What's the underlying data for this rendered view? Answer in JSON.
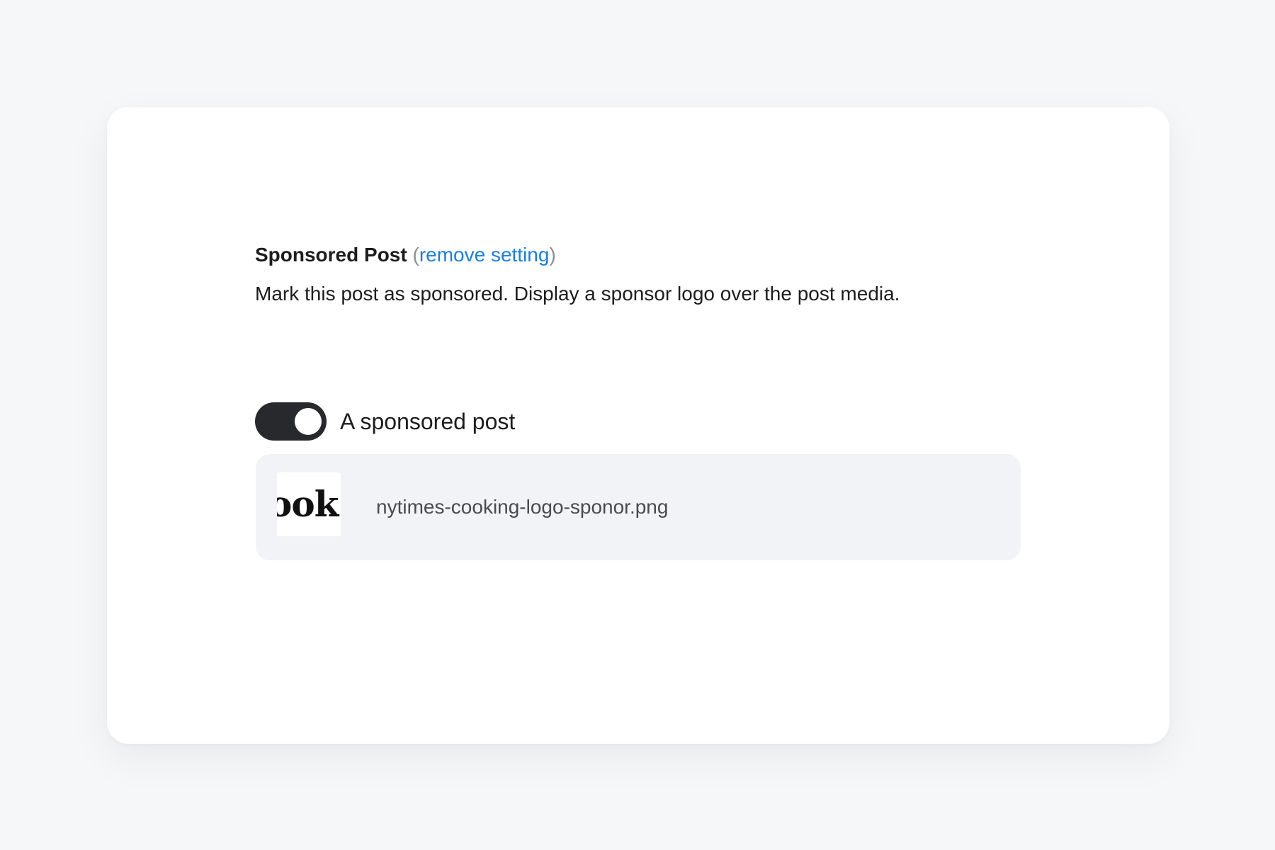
{
  "setting": {
    "title": "Sponsored Post",
    "paren_open": "(",
    "remove_label": "remove setting",
    "paren_close": ")",
    "description": "Mark this post as sponsored. Display a sponsor logo over the post media."
  },
  "toggle": {
    "label": "A sponsored post",
    "state": "on"
  },
  "file": {
    "name": "nytimes-cooking-logo-sponor.png",
    "thumbnail_text": "ook"
  },
  "colors": {
    "background": "#f6f7f9",
    "card": "#ffffff",
    "link": "#1a7ee6",
    "toggle_on": "#27292c",
    "file_box": "#f1f3f6"
  }
}
